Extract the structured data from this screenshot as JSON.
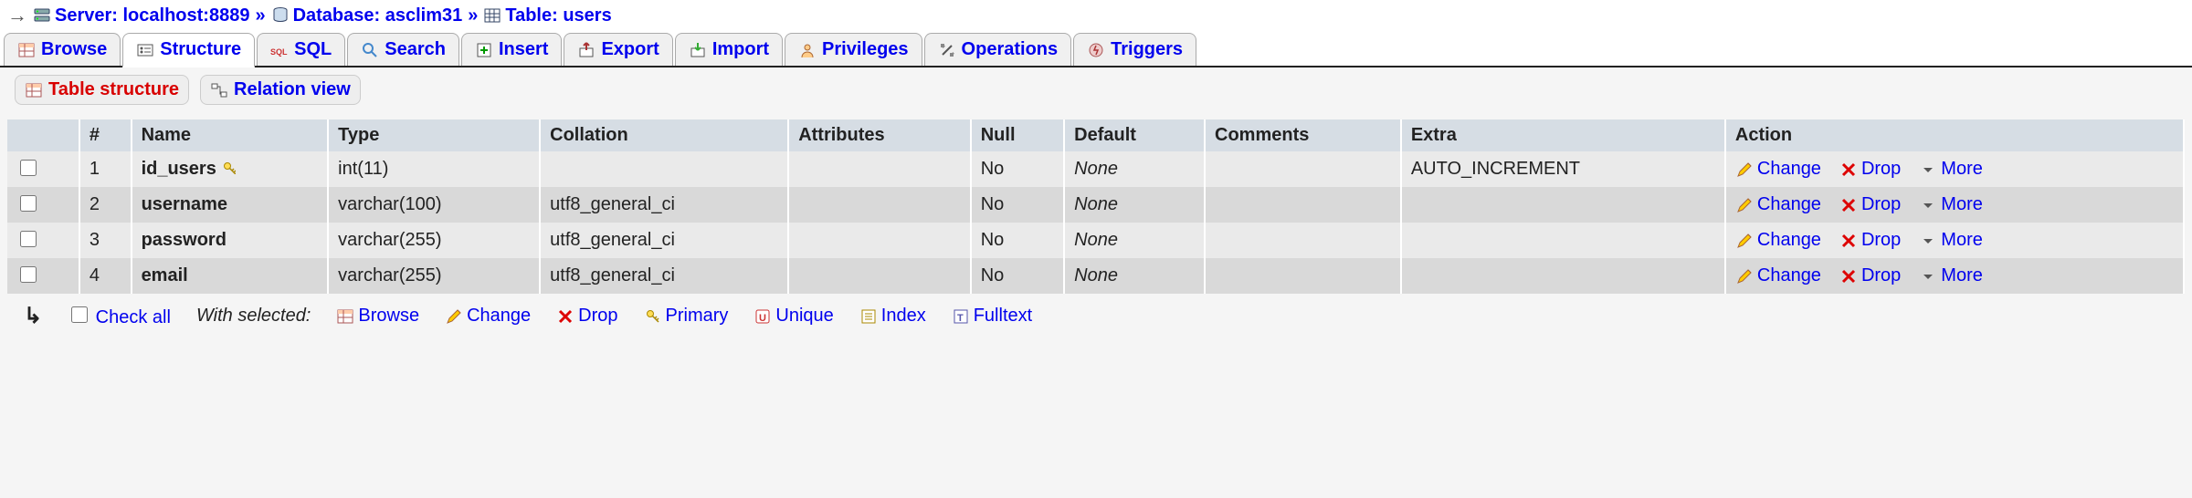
{
  "breadcrumb": {
    "server_label": "Server: localhost:8889",
    "database_label": "Database: asclim31",
    "table_label": "Table: users"
  },
  "tabs": {
    "browse": "Browse",
    "structure": "Structure",
    "sql": "SQL",
    "search": "Search",
    "insert": "Insert",
    "export": "Export",
    "import": "Import",
    "privileges": "Privileges",
    "operations": "Operations",
    "triggers": "Triggers"
  },
  "subtabs": {
    "table_structure": "Table structure",
    "relation_view": "Relation view"
  },
  "headers": {
    "num": "#",
    "name": "Name",
    "type": "Type",
    "collation": "Collation",
    "attributes": "Attributes",
    "null": "Null",
    "default": "Default",
    "comments": "Comments",
    "extra": "Extra",
    "action": "Action"
  },
  "rows": [
    {
      "num": "1",
      "name": "id_users",
      "type": "int(11)",
      "collation": "",
      "attributes": "",
      "null": "No",
      "default": "None",
      "comments": "",
      "extra": "AUTO_INCREMENT",
      "is_key": true
    },
    {
      "num": "2",
      "name": "username",
      "type": "varchar(100)",
      "collation": "utf8_general_ci",
      "attributes": "",
      "null": "No",
      "default": "None",
      "comments": "",
      "extra": "",
      "is_key": false
    },
    {
      "num": "3",
      "name": "password",
      "type": "varchar(255)",
      "collation": "utf8_general_ci",
      "attributes": "",
      "null": "No",
      "default": "None",
      "comments": "",
      "extra": "",
      "is_key": false
    },
    {
      "num": "4",
      "name": "email",
      "type": "varchar(255)",
      "collation": "utf8_general_ci",
      "attributes": "",
      "null": "No",
      "default": "None",
      "comments": "",
      "extra": "",
      "is_key": false
    }
  ],
  "actions": {
    "change": "Change",
    "drop": "Drop",
    "more": "More"
  },
  "bulk": {
    "check_all": "Check all",
    "with_selected": "With selected:",
    "browse": "Browse",
    "change": "Change",
    "drop": "Drop",
    "primary": "Primary",
    "unique": "Unique",
    "index": "Index",
    "fulltext": "Fulltext"
  }
}
